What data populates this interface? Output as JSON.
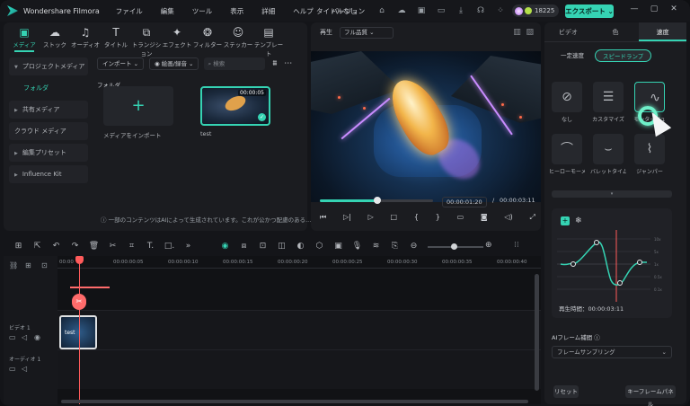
{
  "app": {
    "name": "Wondershare Filmora",
    "project_title": "タイトルなし",
    "credits": "18225",
    "export_label": "エクスポート"
  },
  "menu": [
    "ファイル",
    "編集",
    "ツール",
    "表示",
    "詳細",
    "ヘルプ",
    "バージョン"
  ],
  "media_toolbar": [
    {
      "label": "メディア",
      "icon": "media-icon",
      "glyph": "▣"
    },
    {
      "label": "ストック",
      "icon": "stock-icon",
      "glyph": "☁"
    },
    {
      "label": "オーディオ",
      "icon": "music-icon",
      "glyph": "♫"
    },
    {
      "label": "タイトル",
      "icon": "title-icon",
      "glyph": "T"
    },
    {
      "label": "トランジション",
      "icon": "transition-icon",
      "glyph": "⧉"
    },
    {
      "label": "エフェクト",
      "icon": "effect-icon",
      "glyph": "✦"
    },
    {
      "label": "フィルター",
      "icon": "filter-icon",
      "glyph": "❂"
    },
    {
      "label": "ステッカー",
      "icon": "sticker-icon",
      "glyph": "☺"
    },
    {
      "label": "テンプレート",
      "icon": "template-icon",
      "glyph": "▤"
    }
  ],
  "media_sidebar": [
    "プロジェクトメディア",
    "フォルダ",
    "共有メディア",
    "クラウド メディア",
    "編集プリセット",
    "Influence Kit"
  ],
  "media": {
    "import_select": "インポート",
    "sort_select": "絵画/録音",
    "search_placeholder": "検索",
    "folder_heading": "フォルダ",
    "import_tile_label": "メディアをインポート",
    "clip_name": "test",
    "clip_duration": "00:00:05",
    "ai_notice": "ⓘ 一部のコンテンツはAIによって生成されています。これが公かつ配慮のある..."
  },
  "player": {
    "tab": "再生",
    "quality": "フル品質",
    "current_time": "00:00:01:20",
    "separator": "/",
    "total_time": "00:00:03:11",
    "progress": 0.51
  },
  "right_panel": {
    "tabs": [
      "ビデオ",
      "色",
      "速度"
    ],
    "modes": [
      "一定速度",
      "スピードランプ"
    ],
    "presets": [
      "なし",
      "カスタマイズ",
      "モンタージュ",
      "ヒーローモーメント",
      "バレットタイム",
      "ジャンパー"
    ],
    "curve_y_labels": [
      "10x",
      "5x",
      "1x",
      "0.5x",
      "0.1x"
    ],
    "duration_label": "再生時間：00:00:03:11",
    "ai_frame_label": "AIフレーム補間 ⓘ",
    "ai_frame_value": "フレームサンプリング",
    "reset_button": "リセット",
    "keyframe_button": "キーフレームパネル"
  },
  "timeline": {
    "ticks": [
      "00:00",
      "00:00:00:05",
      "00:00:00:10",
      "00:00:00:15",
      "00:00:00:20",
      "00:00:00:25",
      "00:00:00:30",
      "00:00:00:35",
      "00:00:00:40"
    ],
    "video_track": "ビデオ 1",
    "audio_track": "オーディオ 1",
    "clip_label": "test"
  }
}
